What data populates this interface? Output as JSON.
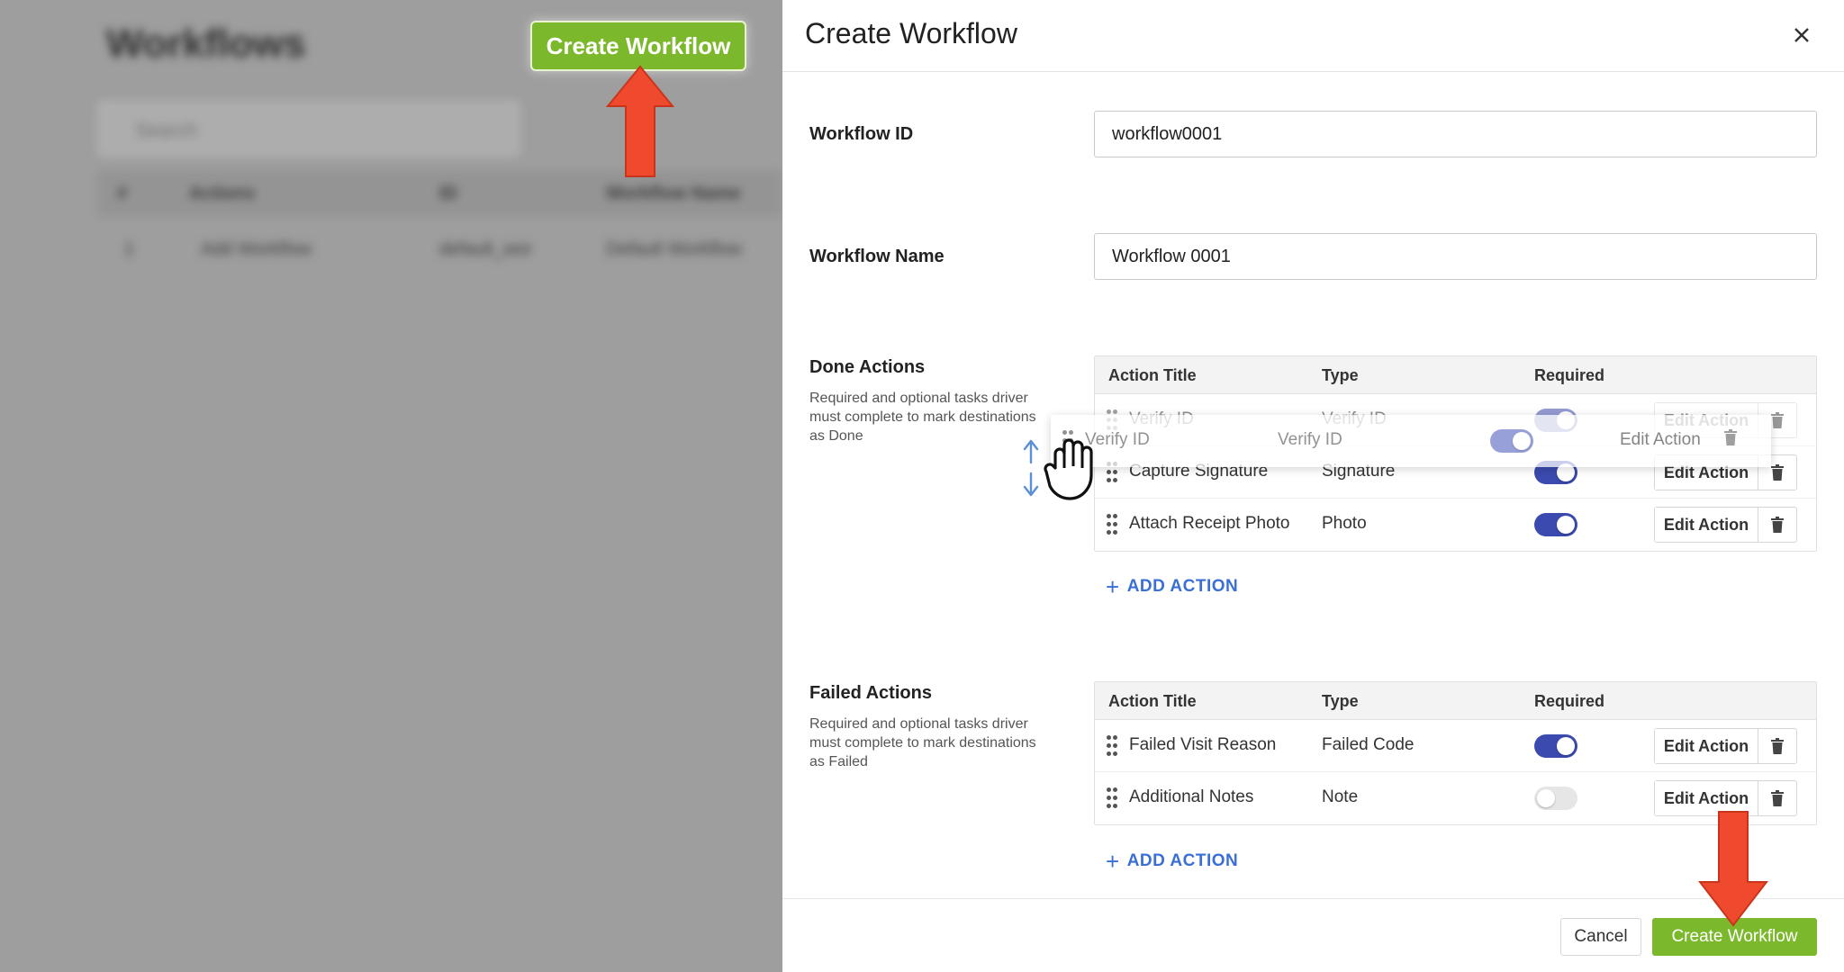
{
  "background": {
    "page_title": "Workflows",
    "search_placeholder": "Search",
    "table_headers": [
      "#",
      "Actions",
      "ID",
      "Workflow Name"
    ],
    "table_row": [
      "1",
      "Add Workflow",
      "default_wor",
      "Default Workflow"
    ],
    "create_button_label": "Create Workflow"
  },
  "modal": {
    "title": "Create Workflow",
    "close_icon": "close-icon",
    "workflow_id": {
      "label": "Workflow ID",
      "value": "workflow0001"
    },
    "workflow_name": {
      "label": "Workflow Name",
      "value": "Workflow 0001"
    },
    "done_actions": {
      "label": "Done Actions",
      "hint": "Required and optional tasks driver must complete to mark destinations as Done",
      "columns": [
        "Action Title",
        "Type",
        "Required"
      ],
      "rows": [
        {
          "title": "Verify ID",
          "type": "Verify ID",
          "required": true,
          "edit_label": "Edit Action"
        },
        {
          "title": "Capture Signature",
          "type": "Signature",
          "required": true,
          "edit_label": "Edit Action"
        },
        {
          "title": "Attach Receipt Photo",
          "type": "Photo",
          "required": true,
          "edit_label": "Edit Action"
        }
      ],
      "add_label": "ADD ACTION",
      "dragging_row": {
        "title": "Verify ID",
        "type": "Verify ID",
        "required": true,
        "edit_label": "Edit Action"
      }
    },
    "failed_actions": {
      "label": "Failed Actions",
      "hint": "Required and optional tasks driver must complete to mark destinations as Failed",
      "columns": [
        "Action Title",
        "Type",
        "Required"
      ],
      "rows": [
        {
          "title": "Failed Visit Reason",
          "type": "Failed Code",
          "required": true,
          "edit_label": "Edit Action"
        },
        {
          "title": "Additional Notes",
          "type": "Note",
          "required": false,
          "edit_label": "Edit Action"
        }
      ],
      "add_label": "ADD ACTION"
    },
    "footer": {
      "cancel_label": "Cancel",
      "create_label": "Create Workflow"
    }
  },
  "colors": {
    "primary_green": "#7cb82b",
    "toggle_on": "#3b4aae",
    "link_blue": "#3a6fd6",
    "annotation_red": "#f04a2e"
  }
}
